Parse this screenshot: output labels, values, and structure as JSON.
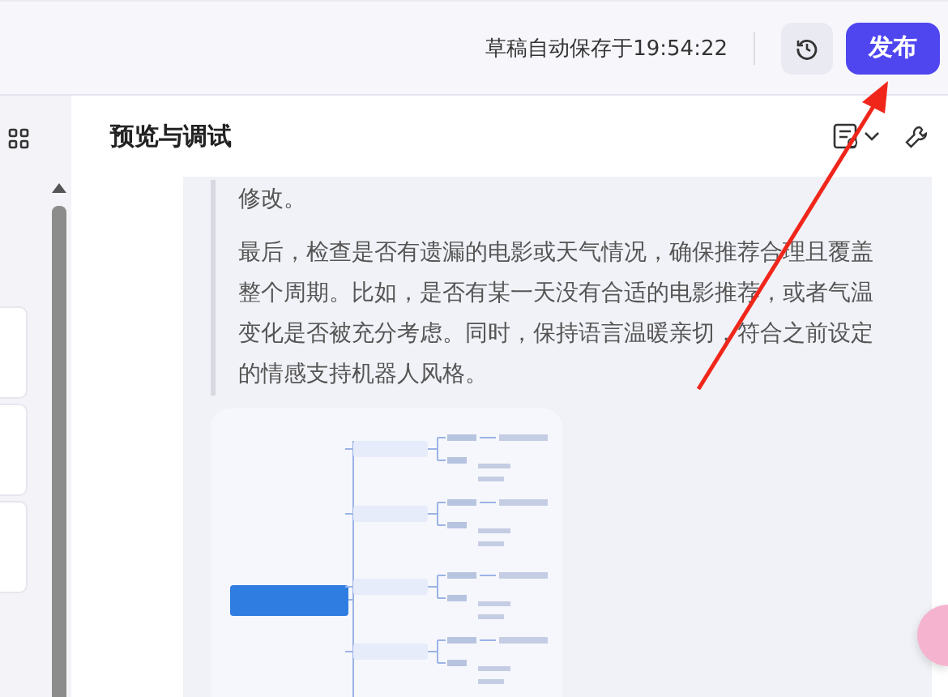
{
  "top_bar": {
    "autosave_text": "草稿自动保存于19:54:22",
    "publish_button": "发布"
  },
  "preview": {
    "title": "预览与调试",
    "message_paragraphs": [
      "修改。",
      "最后，检查是否有遗漏的电影或天气情况，确保推荐合理且覆盖整个周期。比如，是否有某一天没有合适的电影推荐，或者气温变化是否被充分考虑。同时，保持语言温暖亲切，符合之前设定的情感支持机器人风格。"
    ]
  }
}
